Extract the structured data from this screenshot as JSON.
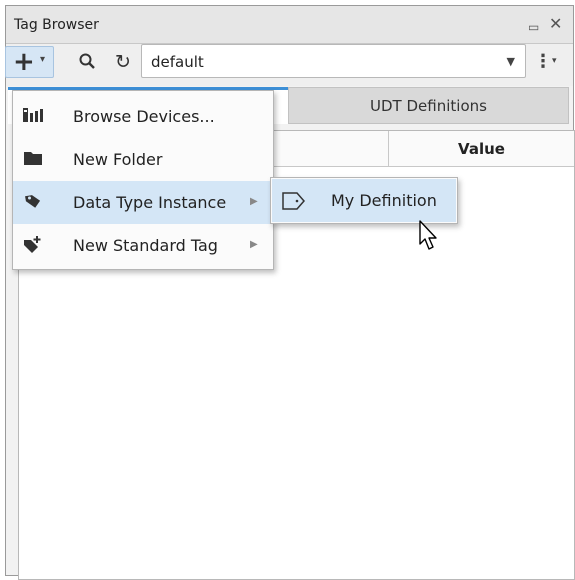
{
  "panel": {
    "title": "Tag Browser"
  },
  "toolbar": {
    "provider_value": "default"
  },
  "tabs": [
    {
      "label": ""
    },
    {
      "label": "UDT Definitions"
    }
  ],
  "table": {
    "columns": [
      "",
      "Value"
    ]
  },
  "add_menu": {
    "items": [
      {
        "label": "Browse Devices...",
        "icon": "devices-icon",
        "submenu": false
      },
      {
        "label": "New Folder",
        "icon": "folder-icon",
        "submenu": false
      },
      {
        "label": "Data Type Instance",
        "icon": "tag-icon",
        "submenu": true,
        "highlighted": true
      },
      {
        "label": "New Standard Tag",
        "icon": "add-tag-icon",
        "submenu": true
      }
    ]
  },
  "submenu": {
    "items": [
      {
        "label": "My Definition",
        "icon": "udt-tag-icon"
      }
    ]
  },
  "colors": {
    "accent": "#3d8fd6",
    "highlight": "#d4e6f6"
  }
}
